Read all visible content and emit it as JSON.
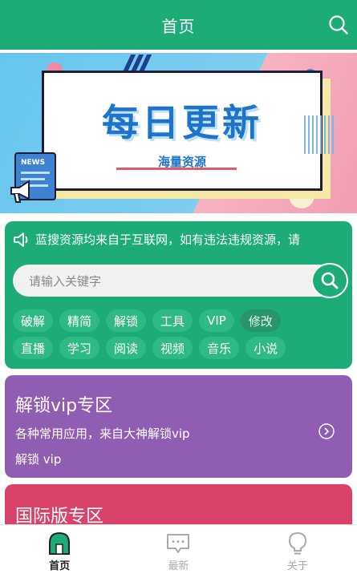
{
  "header": {
    "title": "首页"
  },
  "banner": {
    "title": "每日更新",
    "subtitle": "海量资源",
    "badge": "NEWS"
  },
  "notice": {
    "text": "蓝搜资源均来自于互联网，如有违法违规资源，请"
  },
  "search": {
    "placeholder": "请输入关键字",
    "value": ""
  },
  "tags_row1": [
    "破解",
    "精简",
    "解锁",
    "工具",
    "VIP",
    "修改"
  ],
  "tags_row2": [
    "直播",
    "学习",
    "阅读",
    "视频",
    "音乐",
    "小说"
  ],
  "promo_vip": {
    "title": "解锁vip专区",
    "desc": "各种常用应用，来自大神解锁vip",
    "line2": "解锁 vip"
  },
  "promo_intl": {
    "title": "国际版专区"
  },
  "tabbar": {
    "home": "首页",
    "latest": "最新",
    "about": "关于"
  },
  "colors": {
    "primary": "#1dab78",
    "vip": "#8f5eb3",
    "intl": "#d9436a"
  }
}
